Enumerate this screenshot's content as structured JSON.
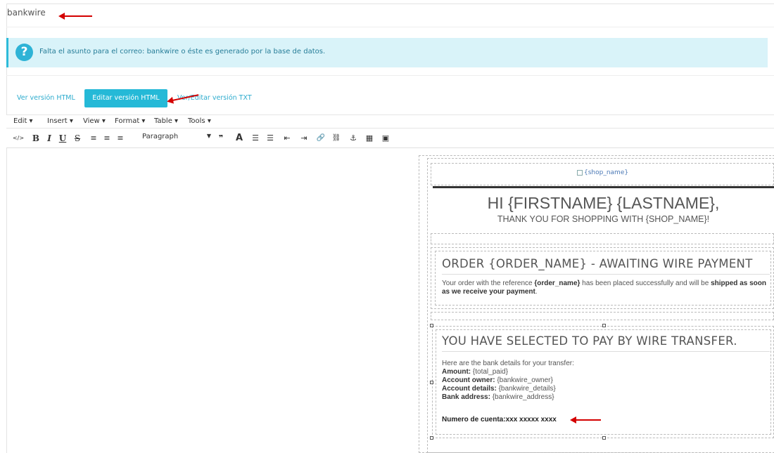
{
  "header": {
    "title": "bankwire"
  },
  "alert": {
    "icon": "question-icon",
    "icon_glyph": "?",
    "message": "Falta el asunto para el correo: bankwire o éste es generado por la base de datos."
  },
  "tabs": [
    {
      "label": "Ver versión HTML",
      "active": false
    },
    {
      "label": "Editar versión HTML",
      "active": true
    },
    {
      "label": "Ver/Editar versión TXT",
      "active": false
    }
  ],
  "menubar": [
    {
      "label": "Edit ▾"
    },
    {
      "label": "Insert ▾"
    },
    {
      "label": "View ▾"
    },
    {
      "label": "Format ▾"
    },
    {
      "label": "Table ▾"
    },
    {
      "label": "Tools ▾"
    }
  ],
  "toolbar": {
    "format_select": "Paragraph",
    "buttons": [
      {
        "name": "source-code-icon",
        "glyph": "</>"
      },
      {
        "name": "bold-icon",
        "glyph": "B"
      },
      {
        "name": "italic-icon",
        "glyph": "I"
      },
      {
        "name": "underline-icon",
        "glyph": "U"
      },
      {
        "name": "strikethrough-icon",
        "glyph": "S"
      },
      {
        "name": "align-left-icon",
        "glyph": "≡"
      },
      {
        "name": "align-center-icon",
        "glyph": "≡"
      },
      {
        "name": "align-right-icon",
        "glyph": "≡"
      },
      {
        "name": "blockquote-icon",
        "glyph": "❞"
      },
      {
        "name": "text-color-icon",
        "glyph": "A"
      },
      {
        "name": "bullet-list-icon",
        "glyph": "☰"
      },
      {
        "name": "numbered-list-icon",
        "glyph": "☰"
      },
      {
        "name": "outdent-icon",
        "glyph": "⇤"
      },
      {
        "name": "indent-icon",
        "glyph": "⇥"
      },
      {
        "name": "link-icon",
        "glyph": "🔗"
      },
      {
        "name": "unlink-icon",
        "glyph": "⛓"
      },
      {
        "name": "anchor-icon",
        "glyph": "⚓"
      },
      {
        "name": "media-icon",
        "glyph": "▦"
      },
      {
        "name": "image-icon",
        "glyph": "▣"
      }
    ]
  },
  "email": {
    "logo_alt": "{shop_name}",
    "greeting": "HI {FIRSTNAME} {LASTNAME},",
    "thanks": "THANK YOU FOR SHOPPING WITH {SHOP_NAME}!",
    "order_title": "ORDER {ORDER_NAME} - AWAITING WIRE PAYMENT",
    "order_text_1": "Your order with the reference ",
    "order_ref": "{order_name}",
    "order_text_2": " has been placed successfully and will be ",
    "order_bold": "shipped as soon as we receive your payment",
    "order_end": ".",
    "wire_title": "YOU HAVE SELECTED TO PAY BY WIRE TRANSFER.",
    "bank_intro": "Here are the bank details for your transfer:",
    "details": [
      {
        "label": "Amount:",
        "value": " {total_paid}"
      },
      {
        "label": "Account owner:",
        "value": " {bankwire_owner}"
      },
      {
        "label": "Account details:",
        "value": " {bankwire_details}"
      },
      {
        "label": "Bank address:",
        "value": " {bankwire_address}"
      }
    ],
    "account_number": "Numero de cuenta:xxx xxxxx xxxx"
  },
  "colors": {
    "accent": "#25b9d7",
    "alert_bg": "#d9f3f9",
    "arrow": "#d40000"
  }
}
